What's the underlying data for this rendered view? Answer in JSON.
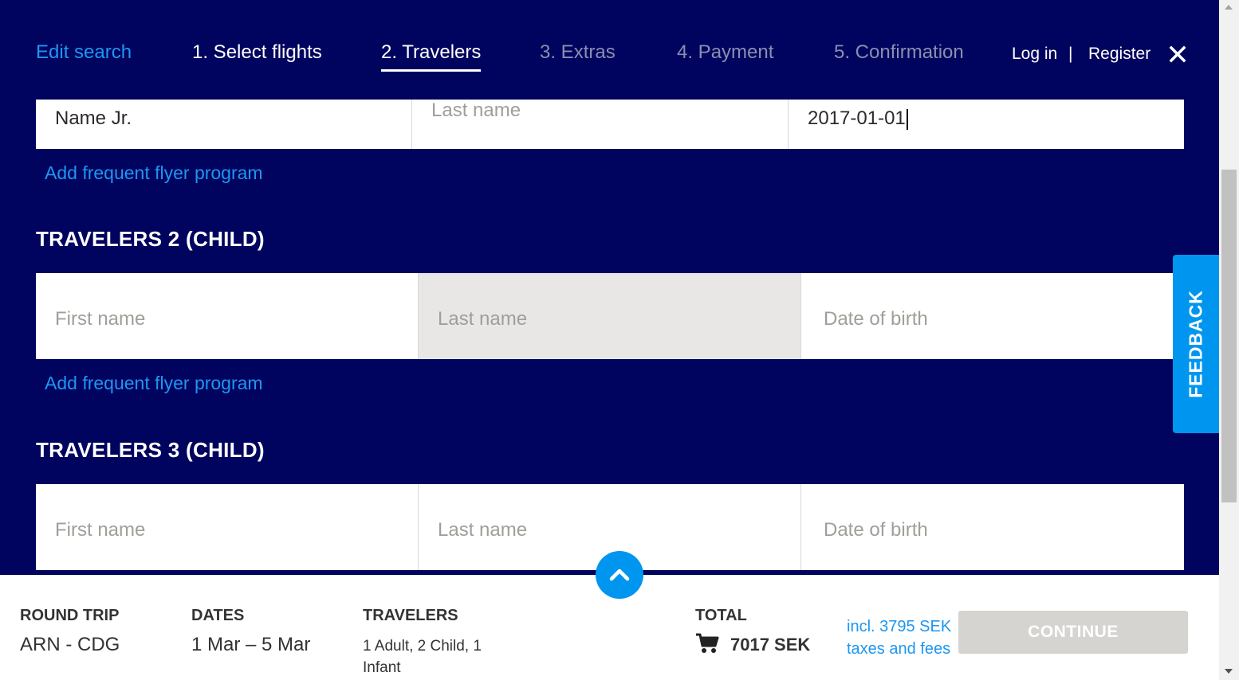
{
  "nav": {
    "edit_search": "Edit search",
    "steps": [
      "1. Select flights",
      "2. Travelers",
      "3. Extras",
      "4. Payment",
      "5. Confirmation"
    ],
    "active_step": 2,
    "login": "Log in",
    "separator": "|",
    "register": "Register",
    "close_icon": "close-icon"
  },
  "traveler1": {
    "first_name_value": "Name Jr.",
    "last_name_placeholder": "Last name",
    "dob_value": "2017-01-01",
    "add_ff": "Add frequent flyer program"
  },
  "traveler2": {
    "title": "TRAVELERS 2 (CHILD)",
    "first_name_placeholder": "First name",
    "last_name_placeholder": "Last name",
    "dob_placeholder": "Date of birth",
    "add_ff": "Add frequent flyer program"
  },
  "traveler3": {
    "title": "TRAVELERS 3 (CHILD)",
    "first_name_placeholder": "First name",
    "last_name_placeholder": "Last name",
    "dob_placeholder": "Date of birth"
  },
  "feedback": "FEEDBACK",
  "summary": {
    "trip_label": "ROUND TRIP",
    "trip_value": "ARN - CDG",
    "dates_label": "DATES",
    "dates_value": "1 Mar – 5 Mar",
    "travelers_label": "TRAVELERS",
    "travelers_value": "1 Adult, 2 Child, 1 Infant",
    "total_label": "TOTAL",
    "total_value": "7017 SEK",
    "taxes_line1": "incl. 3795 SEK",
    "taxes_line2": "taxes and fees",
    "continue": "CONTINUE"
  },
  "colors": {
    "background": "#00045e",
    "accent": "#1e96f0",
    "feedback": "#0096f0",
    "disabled_button": "#d5d4d1"
  }
}
